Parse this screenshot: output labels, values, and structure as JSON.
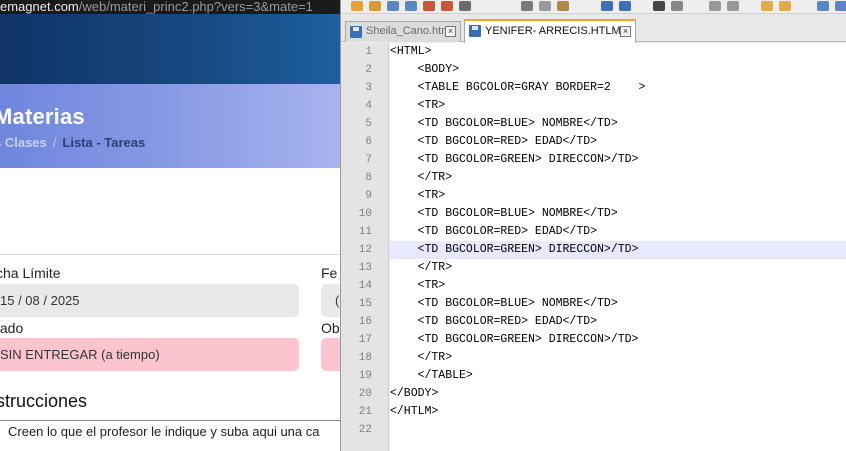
{
  "browser": {
    "url_host": "emagnet.com",
    "url_path": "/web/materi_princ2.php?vers=3&mate=1",
    "page_title": "Materias",
    "breadcrumb": [
      "s Clases",
      "Lista - Tareas"
    ],
    "breadcrumb_sep": "/",
    "fields": {
      "deadline_label": "cha Límite",
      "deadline_value": "15 / 08 / 2025",
      "other_date_label": "Fe",
      "other_date_value": "(",
      "status_label": "tado",
      "status_value": "SIN ENTREGAR (a tiempo)",
      "obs_label": "Ob"
    },
    "instructions_title": "strucciones",
    "instructions_text": "Creen lo que el profesor le indique y suba aqui una ca",
    "colors": {
      "banner": "#184a82",
      "hero": "#8a9ce6",
      "status_bg": "#fbc4cf"
    }
  },
  "editor": {
    "tabs": [
      {
        "label": "Sheila_Cano.html",
        "active": false
      },
      {
        "label": "YENIFER- ARRECIS.HTLM",
        "active": true
      }
    ],
    "current_line": 12,
    "lines": [
      "<HTML>",
      "    <BODY>",
      "    <TABLE BGCOLOR=GRAY BORDER=2    >",
      "    <TR>",
      "    <TD BGCOLOR=BLUE> NOMBRE</TD>",
      "    <TD BGCOLOR=RED> EDAD</TD>",
      "    <TD BGCOLOR=GREEN> DIRECCON>/TD>",
      "    </TR>",
      "    <TR>",
      "    <TD BGCOLOR=BLUE> NOMBRE</TD>",
      "    <TD BGCOLOR=RED> EDAD</TD>",
      "    <TD BGCOLOR=GREEN> DIRECCON>/TD>",
      "    </TR>",
      "    <TR>",
      "    <TD BGCOLOR=BLUE> NOMBRE</TD>",
      "    <TD BGCOLOR=RED> EDAD</TD>",
      "    <TD BGCOLOR=GREEN> DIRECCON>/TD>",
      "    </TR>",
      "    </TABLE>",
      "</BODY>",
      "</HTLM>",
      ""
    ]
  }
}
